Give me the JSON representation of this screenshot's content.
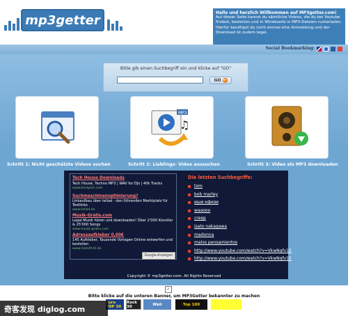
{
  "header": {
    "logo_text": "mp3getter",
    "welcome_title": "Hallo und herzlich Willkommen auf MP3getter.com!",
    "welcome_body": "Auf dieser Seite kannst du sämtliche Videos, die du bei Youtube findest, kostenlos und in Windeseile in MP3-Dateien runterladen. Hierfür benötigst du nicht einmal eine Anmeldung und der Download ist zudem legal."
  },
  "social": {
    "label": "Social Bookmarking:",
    "icons": [
      "flag-uk-icon",
      "delicious-icon",
      "bookmark-icon",
      "star-icon"
    ]
  },
  "search": {
    "prompt": "Bitte gib einen Suchbegriff ein und klicke auf \"GO\"",
    "placeholder": "",
    "go_label": "GO"
  },
  "steps": [
    {
      "label": "Schritt 1: Nicht geschützte Videos suchen",
      "icon": "magnifier-window-icon"
    },
    {
      "label": "Schritt 2: Lieblings- Video aussuchen",
      "icon": "media-music-icon"
    },
    {
      "label": "Schritt 3: Video als MP3 downloaden",
      "icon": "speaker-download-icon"
    }
  ],
  "ads": [
    {
      "title": "Tech House Downloads",
      "desc": "Tech House, Techno MP3 | WAV for DJs | 40k Tracks",
      "url": "www.beatport.com"
    },
    {
      "title": "Suchmaschinenoptimierung?",
      "desc": "Linkaufbau über tellad - den führenden Marktplatz für Textlinks",
      "url": "www.tellad.de"
    },
    {
      "title": "Musik-Gratis.com",
      "desc": "Legal Musik hören und downloaden! Über 2'000 Künstler & 25'000 Songs",
      "url": "www.musik-gratis.com"
    },
    {
      "title": "Adressaufkleber 0,00€",
      "desc": "145 Aufkleber, Tausende Vorlagen Online entwerfen und bestellen",
      "url": "www.VistaPrint.de"
    }
  ],
  "ads_badge": "Google-Anzeigen",
  "recent": {
    "title": "Die letzten Suchbegriffe:",
    "items": [
      "tom",
      "bob marley",
      "иши кфизи",
      "waaooo",
      "creep",
      "isato nakagawa",
      "madonna",
      "malos pensamientos",
      "http://www.youtube.com/watch?v=VkwNqfv1E",
      "http://www.youtube.com/watch?v=VkwNqfv1E"
    ]
  },
  "footer": {
    "copyright": "Copyright © mp3getter.com. All Rights Reserved",
    "banner_note": "Bitte klicke auf die unteren Banner, um MP3Getter bekannter zu machen",
    "banners": [
      "Euro TOP 30",
      "Rock 30",
      "Web",
      "Top 100",
      ""
    ]
  },
  "watermark": "奇客发现 diglog.com",
  "colors": {
    "brand_blue": "#3a7bb5",
    "dark_panel": "#101a38",
    "accent_red": "#ff5a3a",
    "go_orange": "#ef7a1a"
  }
}
